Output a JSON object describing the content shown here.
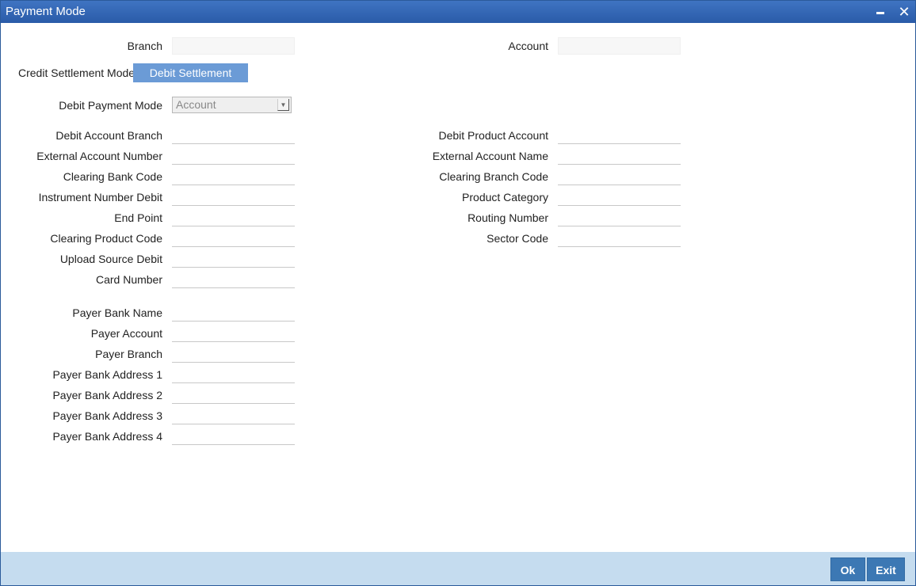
{
  "window": {
    "title": "Payment Mode"
  },
  "header": {
    "branch_label": "Branch",
    "branch_value": "",
    "account_label": "Account",
    "account_value": ""
  },
  "tabs": [
    {
      "label": "Credit Settlement Mode",
      "active": false
    },
    {
      "label": "Debit Settlement Mode",
      "active": true
    }
  ],
  "debit_payment_mode": {
    "label": "Debit Payment Mode",
    "selected": "Account"
  },
  "left_fields": [
    {
      "label": "Debit Account Branch",
      "value": ""
    },
    {
      "label": "External Account Number",
      "value": ""
    },
    {
      "label": "Clearing Bank Code",
      "value": ""
    },
    {
      "label": "Instrument Number Debit",
      "value": ""
    },
    {
      "label": "End Point",
      "value": ""
    },
    {
      "label": "Clearing Product Code",
      "value": ""
    },
    {
      "label": "Upload Source Debit",
      "value": ""
    },
    {
      "label": "Card Number",
      "value": ""
    }
  ],
  "right_fields": [
    {
      "label": "Debit Product Account",
      "value": ""
    },
    {
      "label": "External Account Name",
      "value": ""
    },
    {
      "label": "Clearing Branch Code",
      "value": ""
    },
    {
      "label": "Product Category",
      "value": ""
    },
    {
      "label": "Routing Number",
      "value": ""
    },
    {
      "label": "Sector Code",
      "value": ""
    }
  ],
  "payer_fields": [
    {
      "label": "Payer Bank Name",
      "value": ""
    },
    {
      "label": "Payer Account",
      "value": ""
    },
    {
      "label": "Payer Branch",
      "value": ""
    },
    {
      "label": "Payer Bank Address 1",
      "value": ""
    },
    {
      "label": "Payer Bank Address 2",
      "value": ""
    },
    {
      "label": "Payer Bank Address 3",
      "value": ""
    },
    {
      "label": "Payer Bank Address 4",
      "value": ""
    }
  ],
  "footer": {
    "ok_label": "Ok",
    "exit_label": "Exit"
  }
}
